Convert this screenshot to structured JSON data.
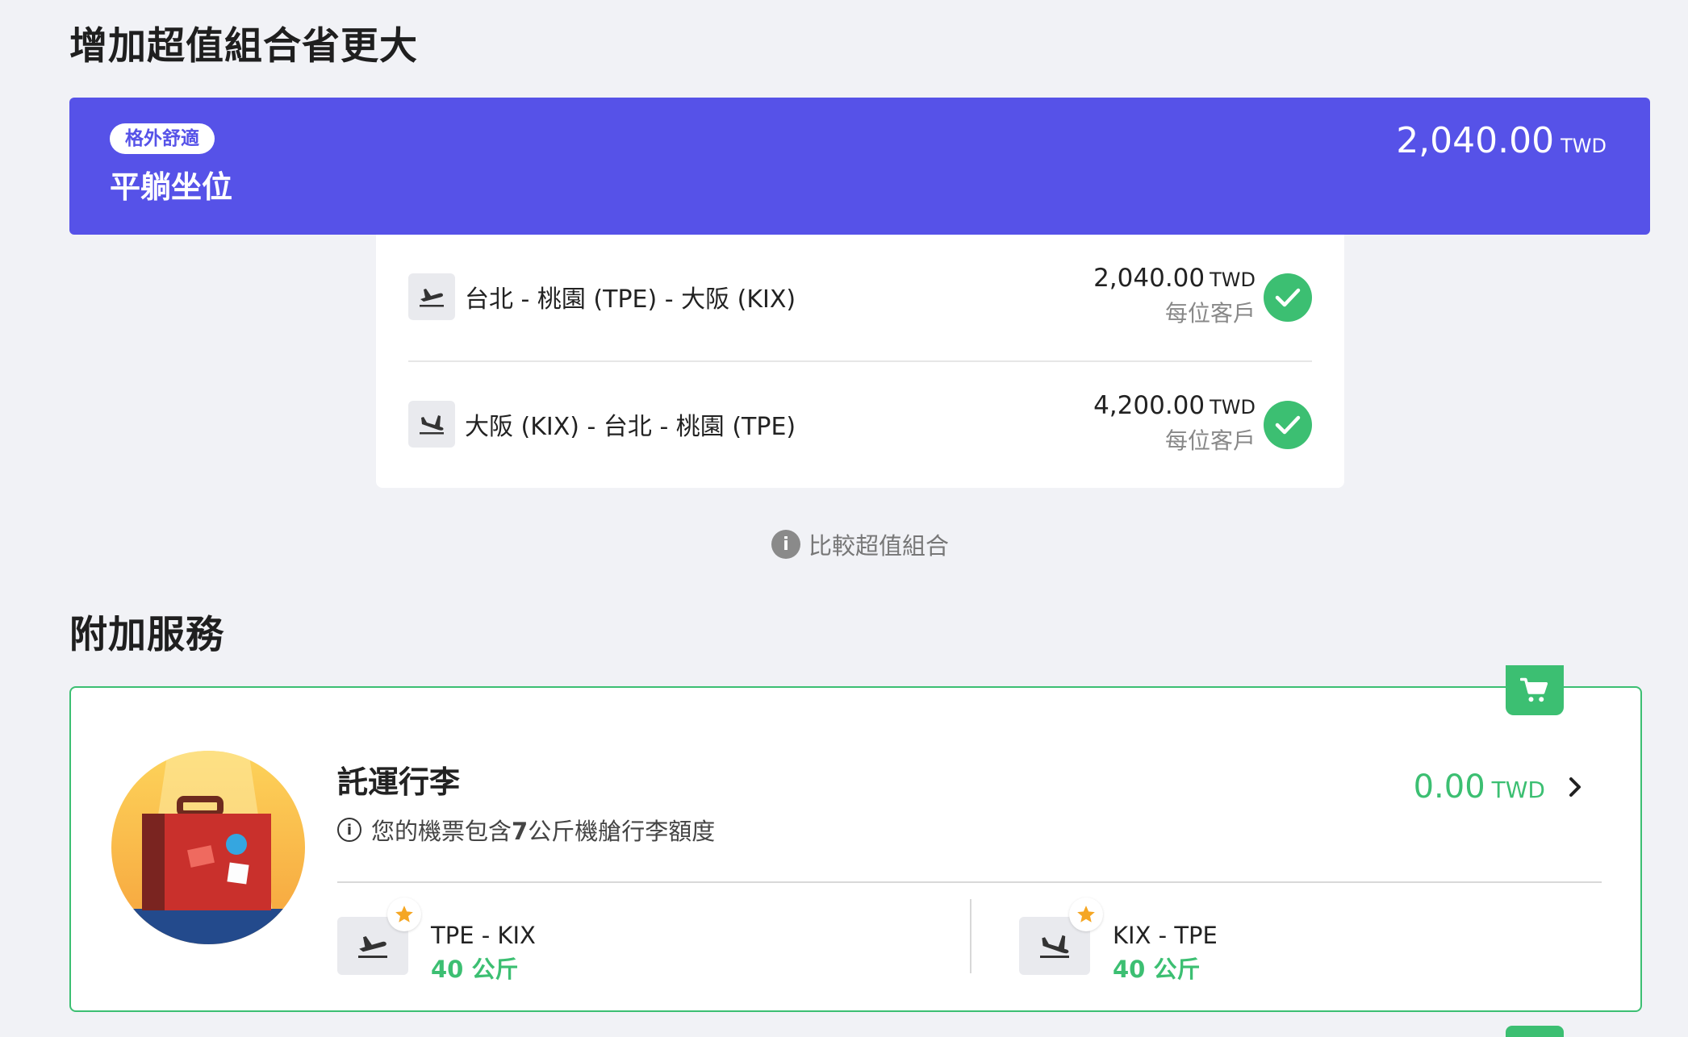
{
  "bundle_section": {
    "title": "增加超值組合省更大",
    "badge": "格外舒適",
    "name": "平躺坐位",
    "price": "2,040.00",
    "currency": "TWD",
    "flights": [
      {
        "route": "台北 - 桃園 (TPE) - 大阪 (KIX)",
        "price": "2,040.00",
        "currency": "TWD",
        "per_person": "每位客戶",
        "icon": "takeoff-icon",
        "selected": true
      },
      {
        "route": "大阪 (KIX) - 台北 - 桃園 (TPE)",
        "price": "4,200.00",
        "currency": "TWD",
        "per_person": "每位客戶",
        "icon": "landing-icon",
        "selected": true
      }
    ],
    "compare_link": "比較超值組合"
  },
  "addons_section": {
    "title": "附加服務",
    "checked_baggage": {
      "title": "託運行李",
      "note_pre": "您的機票包含",
      "note_num": "7",
      "note_post": "公斤機艙行李額度",
      "price": "0.00",
      "currency": "TWD",
      "legs": [
        {
          "route": "TPE - KIX",
          "weight": "40 公斤"
        },
        {
          "route": "KIX - TPE",
          "weight": "40 公斤"
        }
      ]
    }
  },
  "colors": {
    "bundle_purple": "#5652e8",
    "success_green": "#3cbf72",
    "background": "#f1f2f6"
  }
}
